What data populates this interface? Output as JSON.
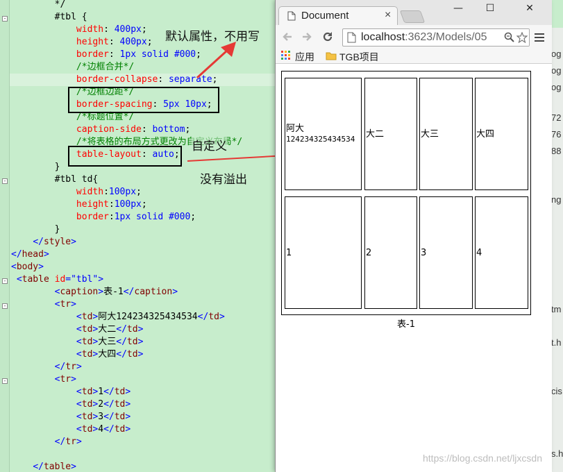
{
  "editor": {
    "lines": [
      [
        [
          "t",
          "        */"
        ]
      ],
      [
        [
          "t",
          "        #tbl {"
        ]
      ],
      [
        [
          "prop",
          "            width"
        ],
        [
          "t",
          ": "
        ],
        [
          "v",
          "400px"
        ],
        [
          "t",
          ";"
        ]
      ],
      [
        [
          "prop",
          "            height"
        ],
        [
          "t",
          ": "
        ],
        [
          "v",
          "400px"
        ],
        [
          "t",
          ";"
        ]
      ],
      [
        [
          "prop",
          "            border"
        ],
        [
          "t",
          ": "
        ],
        [
          "v",
          "1px solid #000"
        ],
        [
          "t",
          ";"
        ]
      ],
      [
        [
          "c",
          "            /*边框合并*/"
        ]
      ],
      [
        [
          "prop",
          "            border-collapse"
        ],
        [
          "t",
          ": "
        ],
        [
          "v",
          "separate"
        ],
        [
          "t",
          ";"
        ]
      ],
      [
        [
          "c",
          "            /*边框边距*/"
        ]
      ],
      [
        [
          "prop",
          "            border-spacing"
        ],
        [
          "t",
          ": "
        ],
        [
          "v",
          "5px 10px"
        ],
        [
          "t",
          ";"
        ]
      ],
      [
        [
          "c",
          "            /*标题位置*/"
        ]
      ],
      [
        [
          "prop",
          "            caption-side"
        ],
        [
          "t",
          ": "
        ],
        [
          "v",
          "bottom"
        ],
        [
          "t",
          ";"
        ]
      ],
      [
        [
          "c",
          "            /*将表格的布局方式更改为自定义布局*/"
        ]
      ],
      [
        [
          "prop",
          "            table-layout"
        ],
        [
          "t",
          ": "
        ],
        [
          "v",
          "auto"
        ],
        [
          "t",
          ";"
        ]
      ],
      [
        [
          "t",
          "        }"
        ]
      ],
      [
        [
          "t",
          "        #tbl td{"
        ]
      ],
      [
        [
          "prop",
          "            width"
        ],
        [
          "t",
          ":"
        ],
        [
          "v",
          "100px"
        ],
        [
          "t",
          ";"
        ]
      ],
      [
        [
          "prop",
          "            height"
        ],
        [
          "t",
          ":"
        ],
        [
          "v",
          "100px"
        ],
        [
          "t",
          ";"
        ]
      ],
      [
        [
          "prop",
          "            border"
        ],
        [
          "t",
          ":"
        ],
        [
          "v",
          "1px solid #000"
        ],
        [
          "t",
          ";"
        ]
      ],
      [
        [
          "t",
          "        }"
        ]
      ],
      [
        [
          "t",
          "    "
        ],
        [
          "k",
          "</"
        ],
        [
          "tg",
          "style"
        ],
        [
          "k",
          ">"
        ]
      ],
      [
        [
          "k",
          "</"
        ],
        [
          "tg",
          "head"
        ],
        [
          "k",
          ">"
        ]
      ],
      [
        [
          "k",
          "<"
        ],
        [
          "tg",
          "body"
        ],
        [
          "k",
          ">"
        ]
      ],
      [
        [
          "t",
          " "
        ],
        [
          "k",
          "<"
        ],
        [
          "tg",
          "table "
        ],
        [
          "at",
          "id"
        ],
        [
          "k",
          "="
        ],
        [
          "av",
          "\"tbl\""
        ],
        [
          "k",
          ">"
        ]
      ],
      [
        [
          "t",
          "        "
        ],
        [
          "k",
          "<"
        ],
        [
          "tg",
          "caption"
        ],
        [
          "k",
          ">"
        ],
        [
          "t",
          "表-1"
        ],
        [
          "k",
          "</"
        ],
        [
          "tg",
          "caption"
        ],
        [
          "k",
          ">"
        ]
      ],
      [
        [
          "t",
          "        "
        ],
        [
          "k",
          "<"
        ],
        [
          "tg",
          "tr"
        ],
        [
          "k",
          ">"
        ]
      ],
      [
        [
          "t",
          "            "
        ],
        [
          "k",
          "<"
        ],
        [
          "tg",
          "td"
        ],
        [
          "k",
          ">"
        ],
        [
          "t",
          "阿大124234325434534"
        ],
        [
          "k",
          "</"
        ],
        [
          "tg",
          "td"
        ],
        [
          "k",
          ">"
        ]
      ],
      [
        [
          "t",
          "            "
        ],
        [
          "k",
          "<"
        ],
        [
          "tg",
          "td"
        ],
        [
          "k",
          ">"
        ],
        [
          "t",
          "大二"
        ],
        [
          "k",
          "</"
        ],
        [
          "tg",
          "td"
        ],
        [
          "k",
          ">"
        ]
      ],
      [
        [
          "t",
          "            "
        ],
        [
          "k",
          "<"
        ],
        [
          "tg",
          "td"
        ],
        [
          "k",
          ">"
        ],
        [
          "t",
          "大三"
        ],
        [
          "k",
          "</"
        ],
        [
          "tg",
          "td"
        ],
        [
          "k",
          ">"
        ]
      ],
      [
        [
          "t",
          "            "
        ],
        [
          "k",
          "<"
        ],
        [
          "tg",
          "td"
        ],
        [
          "k",
          ">"
        ],
        [
          "t",
          "大四"
        ],
        [
          "k",
          "</"
        ],
        [
          "tg",
          "td"
        ],
        [
          "k",
          ">"
        ]
      ],
      [
        [
          "t",
          "        "
        ],
        [
          "k",
          "</"
        ],
        [
          "tg",
          "tr"
        ],
        [
          "k",
          ">"
        ]
      ],
      [
        [
          "t",
          "        "
        ],
        [
          "k",
          "<"
        ],
        [
          "tg",
          "tr"
        ],
        [
          "k",
          ">"
        ]
      ],
      [
        [
          "t",
          "            "
        ],
        [
          "k",
          "<"
        ],
        [
          "tg",
          "td"
        ],
        [
          "k",
          ">"
        ],
        [
          "t",
          "1"
        ],
        [
          "k",
          "</"
        ],
        [
          "tg",
          "td"
        ],
        [
          "k",
          ">"
        ]
      ],
      [
        [
          "t",
          "            "
        ],
        [
          "k",
          "<"
        ],
        [
          "tg",
          "td"
        ],
        [
          "k",
          ">"
        ],
        [
          "t",
          "2"
        ],
        [
          "k",
          "</"
        ],
        [
          "tg",
          "td"
        ],
        [
          "k",
          ">"
        ]
      ],
      [
        [
          "t",
          "            "
        ],
        [
          "k",
          "<"
        ],
        [
          "tg",
          "td"
        ],
        [
          "k",
          ">"
        ],
        [
          "t",
          "3"
        ],
        [
          "k",
          "</"
        ],
        [
          "tg",
          "td"
        ],
        [
          "k",
          ">"
        ]
      ],
      [
        [
          "t",
          "            "
        ],
        [
          "k",
          "<"
        ],
        [
          "tg",
          "td"
        ],
        [
          "k",
          ">"
        ],
        [
          "t",
          "4"
        ],
        [
          "k",
          "</"
        ],
        [
          "tg",
          "td"
        ],
        [
          "k",
          ">"
        ]
      ],
      [
        [
          "t",
          "        "
        ],
        [
          "k",
          "</"
        ],
        [
          "tg",
          "tr"
        ],
        [
          "k",
          ">"
        ]
      ],
      [
        [
          "t",
          ""
        ]
      ],
      [
        [
          "t",
          "    "
        ],
        [
          "k",
          "</"
        ],
        [
          "tg",
          "table"
        ],
        [
          "k",
          ">"
        ]
      ]
    ]
  },
  "annotations": {
    "default_attr": "默认属性，不用写",
    "custom": "自定义",
    "no_overflow": "没有溢出"
  },
  "side_fragments": [
    "og",
    "og",
    "og",
    "72",
    "76",
    "88",
    "ng",
    "tm",
    "t.h",
    "cis",
    "s.ht"
  ],
  "browser": {
    "tab_title": "Document",
    "tab_close": "×",
    "url_host": "localhost",
    "url_rest": ":3623/Models/05",
    "bookmarks": {
      "apps": "应用",
      "folder": "TGB项目"
    },
    "window_controls": {
      "minimize": "—",
      "maximize": "☐",
      "close": "✕"
    },
    "table": {
      "rows": [
        [
          "阿大124234325434534",
          "大二",
          "大三",
          "大四"
        ],
        [
          "1",
          "2",
          "3",
          "4"
        ]
      ],
      "first_cell_lines": [
        "阿大",
        "124234325434534"
      ],
      "caption": "表-1"
    },
    "watermark": "https://blog.csdn.net/ljxcsdn"
  },
  "colors": {
    "editor_bg": "#c7edcc",
    "arrow": "#e53935"
  }
}
